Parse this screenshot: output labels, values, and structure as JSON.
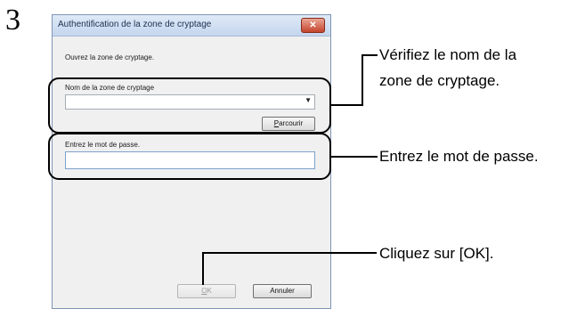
{
  "step_number": "3",
  "dialog": {
    "title": "Authentification de la zone de cryptage",
    "close_glyph": "✕",
    "instruction": "Ouvrez la zone de cryptage.",
    "zone_name_label": "Nom de la zone de cryptage",
    "zone_name_value": "",
    "browse_label_underlined": "P",
    "browse_label_rest": "arcourir",
    "password_label": "Entrez le mot de passe.",
    "password_value": "",
    "ok_label_underlined": "O",
    "ok_label_rest": "K",
    "cancel_label": "Annuler"
  },
  "annotations": {
    "verify_zone_line1": "Vérifiez le nom de la",
    "verify_zone_line2": "zone de cryptage.",
    "enter_password": "Entrez le mot de passe.",
    "click_ok": "Cliquez sur [OK]."
  },
  "icons": {
    "close": "close-icon",
    "dropdown": "chevron-down-icon"
  }
}
